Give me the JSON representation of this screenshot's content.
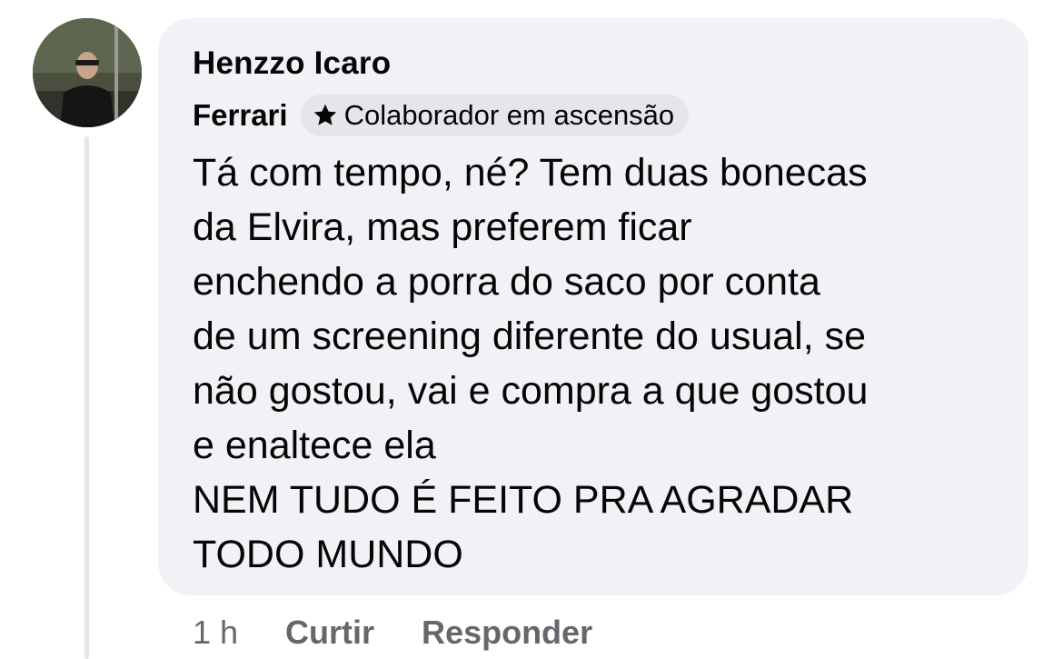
{
  "comment": {
    "author": "Henzzo Icaro",
    "group": "Ferrari",
    "badge": {
      "icon": "star-badge-icon",
      "label": "Colaborador em ascensão"
    },
    "text": "Tá com tempo, né? Tem duas bonecas\nda Elvira, mas preferem ficar\nenchendo a porra do saco por conta\nde um screening diferente do usual, se\nnão gostou, vai e compra a que gostou\ne enaltece ela\nNEM TUDO É FEITO PRA AGRADAR\nTODO MUNDO",
    "time": "1 h",
    "actions": {
      "like": "Curtir",
      "reply": "Responder"
    }
  },
  "colors": {
    "bubble": "#f0f2f5",
    "badge_bg": "#e4e6eb",
    "text": "#050505",
    "secondary_text": "#65676b",
    "thread_line": "#e4e6eb"
  }
}
